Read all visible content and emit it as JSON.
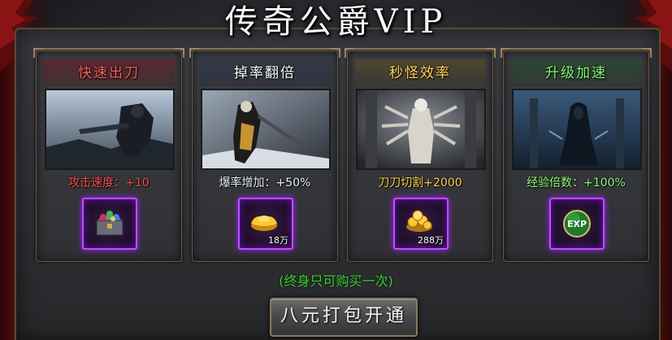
{
  "title": "传奇公爵VIP",
  "cards": [
    {
      "title": "快速出刀",
      "stat": "攻击速度：+10",
      "item_quantity": "",
      "title_color": "#ff5a5a",
      "icon": "treasure-chest-icon"
    },
    {
      "title": "掉率翻倍",
      "stat": "爆率增加：+50%",
      "item_quantity": "18万",
      "title_color": "#ffffff",
      "icon": "gold-ingot-icon"
    },
    {
      "title": "秒怪效率",
      "stat": "刀刀切割+2000",
      "item_quantity": "288万",
      "title_color": "#ffd84a",
      "icon": "gold-coins-icon"
    },
    {
      "title": "升级加速",
      "stat": "经验倍数：+100%",
      "item_quantity": "",
      "title_color": "#7dff6a",
      "icon": "exp-orb-icon"
    }
  ],
  "exp_label": "EXP",
  "note": "(终身只可购买一次)",
  "button_label": "八元打包开通",
  "colors": {
    "slot_border": "#c04cff",
    "note": "#2fd62f",
    "frame_border": "#5a4a34"
  }
}
